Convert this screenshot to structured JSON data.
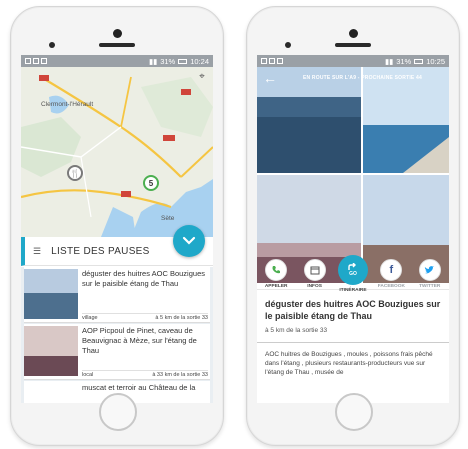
{
  "left_screen": {
    "status": {
      "battery": "31%",
      "time": "10:24"
    },
    "map": {
      "labels": [
        "Clermont-l'Hérault",
        "Sète"
      ],
      "road_badges": [
        "A75",
        "A750",
        "A9",
        "A709",
        "A9"
      ],
      "pins": [
        {
          "glyph": "🍴",
          "icon": "fork-knife-icon"
        },
        {
          "glyph": "5",
          "icon": "number-pin"
        }
      ]
    },
    "list_header": {
      "title": "LISTE DES PAUSES"
    },
    "items": [
      {
        "title": "déguster des huitres AOC Bouzigues sur le paisible étang de Thau",
        "tag": "village",
        "distance": "à 5 km de la sortie 33"
      },
      {
        "title": "AOP Picpoul de Pinet, caveau de Beauvignac à Mèze, sur l'étang de Thau",
        "tag": "local",
        "distance": "à 33 km de la sortie 33"
      },
      {
        "title": "muscat et terroir au Château de la",
        "tag": "",
        "distance": ""
      }
    ]
  },
  "right_screen": {
    "status": {
      "battery": "31%",
      "time": "10:25"
    },
    "header": {
      "route": "EN ROUTE SUR L'A9 - PROCHAINE SORTIE 44"
    },
    "actions": [
      {
        "label": "APPELER",
        "icon": "phone-icon",
        "muted": false
      },
      {
        "label": "INFOS",
        "icon": "calendar-icon",
        "muted": false
      },
      {
        "label": "ITINÉRAIRE",
        "icon": "directions-icon",
        "muted": false,
        "go": "GO"
      },
      {
        "label": "FACEBOOK",
        "icon": "facebook-icon",
        "muted": true
      },
      {
        "label": "TWITTER",
        "icon": "twitter-icon",
        "muted": true
      }
    ],
    "detail": {
      "title": "déguster des huitres AOC Bouzigues sur le paisible étang de Thau",
      "subtitle": "à 5 km de la sortie 33",
      "description": "AOC huitres de Bouzigues , moules , poissons frais pêché dans l'étang , plusieurs restaurants-producteurs vue sur l'étang de Thau , musée de"
    }
  },
  "colors": {
    "accent": "#1fa8c9",
    "statusbar": "#9aa0a6",
    "phone_accent": "#4caf50",
    "facebook": "#3b5998",
    "twitter": "#1da1f2"
  }
}
